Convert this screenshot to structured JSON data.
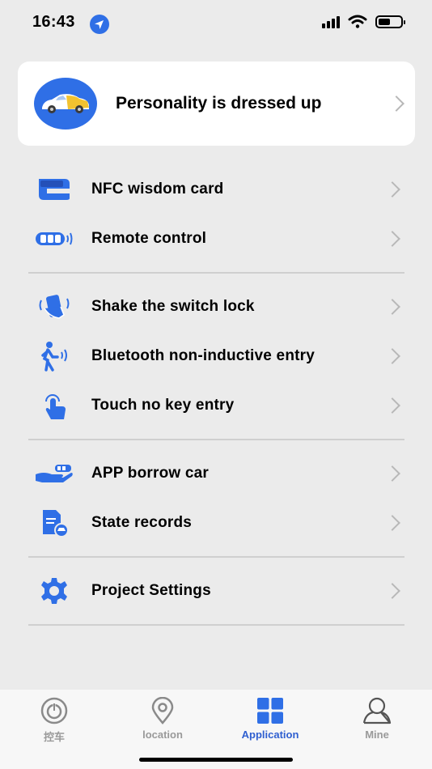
{
  "status": {
    "time": "16:43"
  },
  "top_card": {
    "title": "Personality is dressed up"
  },
  "menu": [
    {
      "label": "NFC wisdom card",
      "icon": "nfc-card-icon"
    },
    {
      "label": "Remote control",
      "icon": "remote-key-icon"
    },
    {
      "label": "Shake the switch lock",
      "icon": "shake-phone-icon"
    },
    {
      "label": "Bluetooth non-inductive entry",
      "icon": "walking-bluetooth-icon"
    },
    {
      "label": "Touch no key entry",
      "icon": "touch-hand-icon"
    },
    {
      "label": "APP borrow car",
      "icon": "hand-key-icon"
    },
    {
      "label": "State records",
      "icon": "records-document-icon"
    },
    {
      "label": "Project Settings",
      "icon": "gear-icon"
    }
  ],
  "tabs": [
    {
      "label": "控车",
      "icon": "power-icon",
      "active": false
    },
    {
      "label": "location",
      "icon": "location-pin-icon",
      "active": false
    },
    {
      "label": "Application",
      "icon": "grid-icon",
      "active": true
    },
    {
      "label": "Mine",
      "icon": "person-icon",
      "active": false
    }
  ],
  "colors": {
    "accent": "#2f6fe6",
    "background": "#ebebeb",
    "active_tab": "#2f5fd0",
    "inactive_tab": "#9a9a9a"
  }
}
